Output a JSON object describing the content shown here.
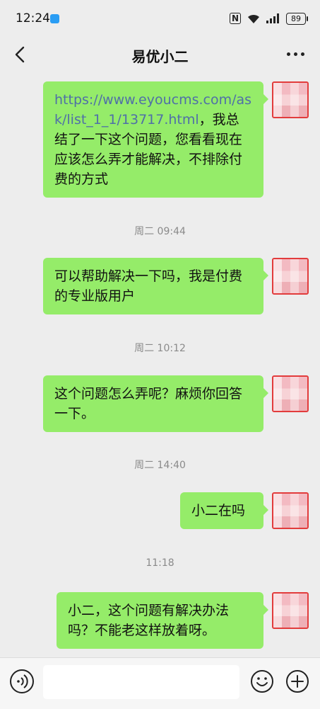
{
  "status_bar": {
    "time": "12:24",
    "nfc_label": "N",
    "battery_level": "89"
  },
  "nav": {
    "title": "易优小二"
  },
  "messages": [
    {
      "link": "https://www.eyoucms.com/ask/list_1_1/13717.html",
      "text": "，我总结了一下这个问题，您看看现在应该怎么弄才能解决，不排除付费的方式"
    },
    {
      "divider": "周二 09:44"
    },
    {
      "text": "可以帮助解决一下吗，我是付费的专业版用户"
    },
    {
      "divider": "周二 10:12"
    },
    {
      "text": "这个问题怎么弄呢？麻烦你回答一下。"
    },
    {
      "divider": "周二 14:40"
    },
    {
      "text": "小二在吗"
    },
    {
      "divider": "11:18"
    },
    {
      "text": "小二，这个问题有解决办法吗？不能老这样放着呀。"
    }
  ],
  "input": {
    "value": ""
  },
  "colors": {
    "background": "#ededed",
    "bubble_self": "#95ec69",
    "link": "#4f6fa8",
    "timestamp": "#8a8a8a"
  }
}
